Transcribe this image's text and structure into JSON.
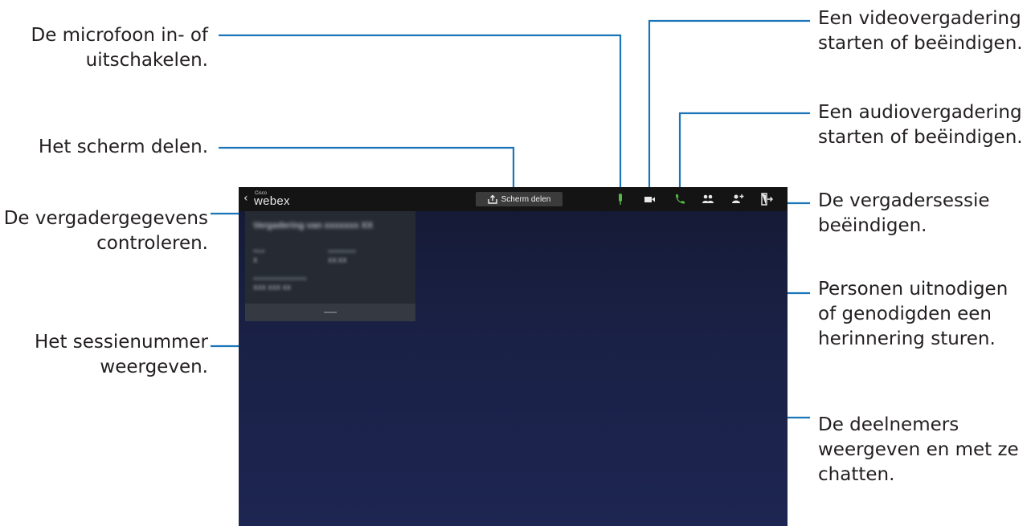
{
  "callouts": {
    "mic": [
      "De microfoon in- of",
      "uitschakelen."
    ],
    "share": [
      "Het scherm delen."
    ],
    "info": [
      "De vergadergegevens",
      "controleren."
    ],
    "session": [
      "Het sessienummer",
      "weergeven."
    ],
    "video": [
      "Een videovergadering",
      "starten of beëindigen."
    ],
    "audio": [
      "Een audiovergadering",
      "starten of beëindigen."
    ],
    "end": [
      "De vergadersessie",
      "beëindigen."
    ],
    "invite": [
      "Personen uitnodigen",
      "of genodigden een",
      "herinnering sturen."
    ],
    "participants": [
      "De deelnemers",
      "weergeven en met ze",
      "chatten."
    ]
  },
  "app": {
    "logo_small": "Cisco",
    "logo": "webex",
    "share_button": "Scherm delen"
  },
  "icons": {
    "back": "chevron-left-icon",
    "share": "share-upload-icon",
    "mic": "microphone-icon",
    "video": "video-camera-icon",
    "audio": "phone-icon",
    "participants": "participants-icon",
    "invite": "add-person-icon",
    "exit": "exit-icon"
  },
  "colors": {
    "callout_line": "#1b75b8",
    "mic_active": "#55b948",
    "phone_active": "#55b948",
    "actionbar": "#141414",
    "screen_bg": "#1c234d"
  }
}
